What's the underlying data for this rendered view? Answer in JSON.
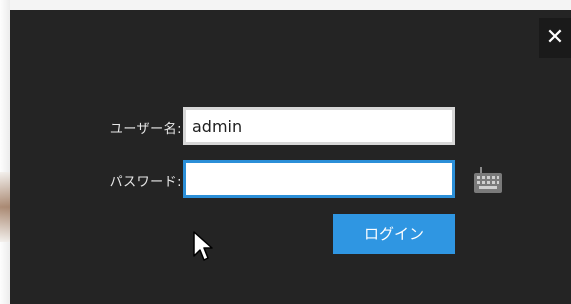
{
  "dialog": {
    "close_icon": "close-icon",
    "close_label": "✕"
  },
  "login_form": {
    "username_label": "ユーザー名:",
    "username_value": "admin",
    "password_label": "パスワード:",
    "password_value": "",
    "keyboard_icon": "keyboard-icon",
    "login_button": "ログイン"
  },
  "colors": {
    "dialog_bg": "#242424",
    "accent": "#2f96e2",
    "focus_border": "#2b8fd8"
  }
}
